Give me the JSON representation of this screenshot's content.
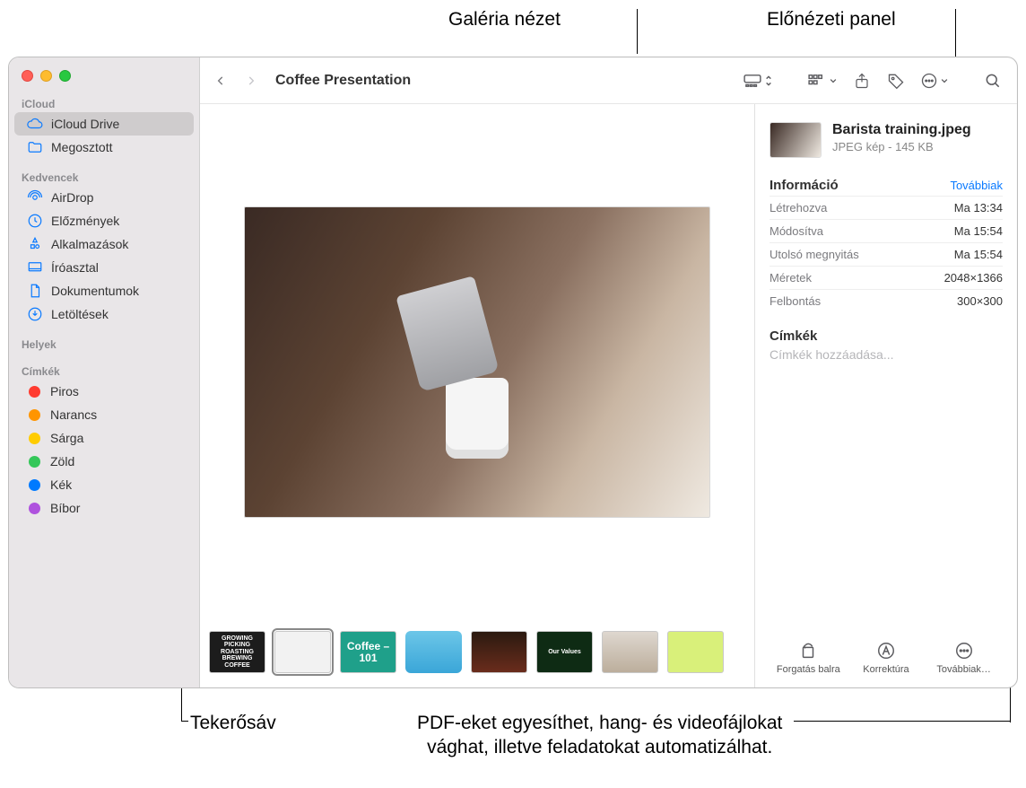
{
  "callouts": {
    "gallery": "Galéria nézet",
    "preview_panel": "Előnézeti panel",
    "thumb_strip": "Tekerősáv",
    "actions_hint_line1": "PDF-eket egyesíthet, hang- és videofájlokat",
    "actions_hint_line2": "vághat, illetve feladatokat automatizálhat."
  },
  "toolbar": {
    "title": "Coffee Presentation"
  },
  "sidebar": {
    "sections": {
      "icloud": "iCloud",
      "favorites": "Kedvencek",
      "locations": "Helyek",
      "tags": "Címkék"
    },
    "icloud_items": [
      {
        "label": "iCloud Drive",
        "icon": "cloud",
        "selected": true
      },
      {
        "label": "Megosztott",
        "icon": "shared-folder",
        "selected": false
      }
    ],
    "favorites": [
      {
        "label": "AirDrop",
        "icon": "airdrop"
      },
      {
        "label": "Előzmények",
        "icon": "clock"
      },
      {
        "label": "Alkalmazások",
        "icon": "apps"
      },
      {
        "label": "Íróasztal",
        "icon": "desktop"
      },
      {
        "label": "Dokumentumok",
        "icon": "doc"
      },
      {
        "label": "Letöltések",
        "icon": "download"
      }
    ],
    "tags": [
      {
        "label": "Piros",
        "color": "#ff3b30"
      },
      {
        "label": "Narancs",
        "color": "#ff9500"
      },
      {
        "label": "Sárga",
        "color": "#ffcc00"
      },
      {
        "label": "Zöld",
        "color": "#34c759"
      },
      {
        "label": "Kék",
        "color": "#007aff"
      },
      {
        "label": "Bíbor",
        "color": "#af52de"
      }
    ]
  },
  "thumbnails": [
    {
      "label": "GROWING PICKING ROASTING BREWING COFFEE"
    },
    {
      "label": ""
    },
    {
      "label": "Coffee – 101"
    },
    {
      "label": ""
    },
    {
      "label": ""
    },
    {
      "label": "Our Values"
    },
    {
      "label": ""
    },
    {
      "label": ""
    }
  ],
  "preview": {
    "filename": "Barista training.jpeg",
    "subtitle": "JPEG kép - 145 KB",
    "info_title": "Információ",
    "more_link": "Továbbiak",
    "rows": [
      {
        "k": "Létrehozva",
        "v": "Ma 13:34"
      },
      {
        "k": "Módosítva",
        "v": "Ma 15:54"
      },
      {
        "k": "Utolsó megnyitás",
        "v": "Ma 15:54"
      },
      {
        "k": "Méretek",
        "v": "2048×1366"
      },
      {
        "k": "Felbontás",
        "v": "300×300"
      }
    ],
    "tags_title": "Címkék",
    "tags_placeholder": "Címkék hozzáadása...",
    "actions": {
      "rotate": "Forgatás balra",
      "markup": "Korrektúra",
      "more": "Továbbiak…"
    }
  }
}
